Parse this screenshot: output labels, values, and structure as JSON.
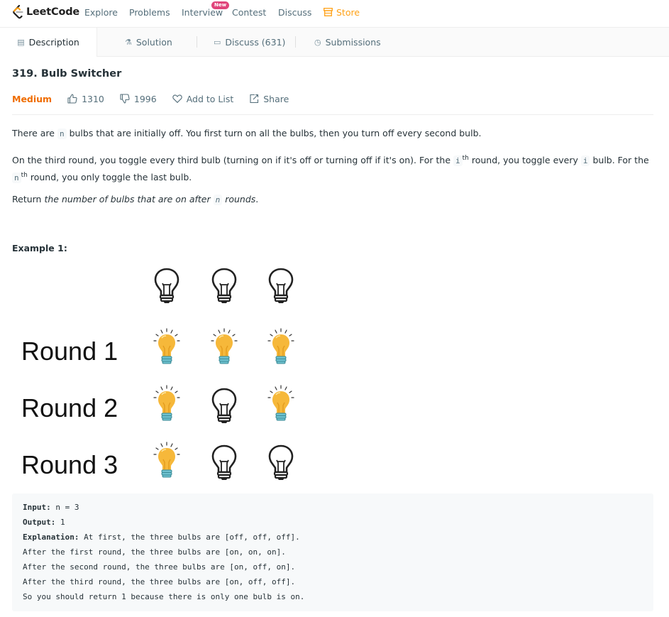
{
  "nav": {
    "logo_text": "LeetCode",
    "links": [
      "Explore",
      "Problems",
      "Interview",
      "Contest",
      "Discuss"
    ],
    "new_badge": "New",
    "store": "Store",
    "accent": "#ffa116"
  },
  "tabs": {
    "description": "Description",
    "solution": "Solution",
    "discuss": "Discuss (631)",
    "submissions": "Submissions"
  },
  "problem": {
    "title": "319. Bulb Switcher",
    "difficulty": "Medium",
    "likes": "1310",
    "dislikes": "1996",
    "add_to_list": "Add to List",
    "share": "Share"
  },
  "description": {
    "p1_a": "There are ",
    "p1_code": "n",
    "p1_b": " bulbs that are initially off. You first turn on all the bulbs, then you turn off every second bulb.",
    "p2_a": "On the third round, you toggle every third bulb (turning on if it's off or turning off if it's on). For the ",
    "p2_code1": "i",
    "p2_sup1": "th",
    "p2_b": " round, you toggle every ",
    "p2_code2": "i",
    "p2_c": " bulb. For the",
    "p2_code3": "n",
    "p2_sup2": "th",
    "p2_d": " round, you only toggle the last bulb.",
    "p3_a": "Return ",
    "p3_em1": "the number of bulbs that are on after ",
    "p3_code": "n",
    "p3_em2": " rounds",
    "p3_b": "."
  },
  "example": {
    "title": "Example 1:",
    "rounds": [
      "Round 1",
      "Round 2",
      "Round 3"
    ],
    "bulb_states": [
      [
        "off",
        "off",
        "off"
      ],
      [
        "on",
        "on",
        "on"
      ],
      [
        "on",
        "off",
        "on"
      ],
      [
        "on",
        "off",
        "off"
      ]
    ],
    "input_label": "Input:",
    "input_value": " n = 3",
    "output_label": "Output:",
    "output_value": " 1",
    "explanation_label": "Explanation:",
    "explanation_value": " At first, the three bulbs are [off, off, off].",
    "lines": [
      "After the first round, the three bulbs are [on, on, on].",
      "After the second round, the three bulbs are [on, off, on].",
      "After the third round, the three bulbs are [on, off, off].",
      "So you should return 1 because there is only one bulb is on."
    ]
  }
}
